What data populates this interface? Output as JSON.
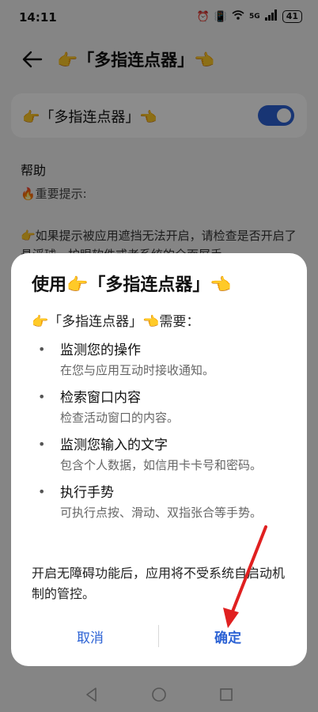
{
  "status_bar": {
    "time": "14:11",
    "network": "5G",
    "battery": "41"
  },
  "header": {
    "title": "👉「多指连点器」👈"
  },
  "toggle": {
    "label": "👉「多指连点器」👈",
    "enabled": true
  },
  "help": {
    "title": "帮助",
    "warning": "🔥重要提示:",
    "body": "👉如果提示被应用遮挡无法开启，请检查是否开启了悬浮球、护眼软件或者系统的全面屏手"
  },
  "dialog": {
    "title": "使用👉「多指连点器」👈",
    "subtitle": "👉「多指连点器」👈需要：",
    "permissions": [
      {
        "title": "监测您的操作",
        "desc": "在您与应用互动时接收通知。"
      },
      {
        "title": "检索窗口内容",
        "desc": "检查活动窗口的内容。"
      },
      {
        "title": "监测您输入的文字",
        "desc": "包含个人数据，如信用卡卡号和密码。"
      },
      {
        "title": "执行手势",
        "desc": "可执行点按、滑动、双指张合等手势。"
      }
    ],
    "note": "开启无障碍功能后，应用将不受系统自启动机制的管控。",
    "cancel_label": "取消",
    "confirm_label": "确定"
  },
  "colors": {
    "accent": "#2c62d4",
    "annotation": "#e02020"
  }
}
